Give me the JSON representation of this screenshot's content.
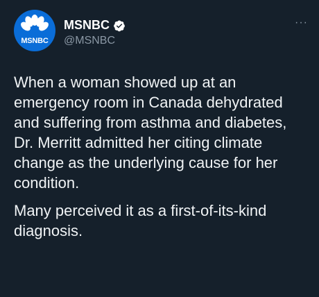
{
  "account": {
    "display_name": "MSNBC",
    "handle": "@MSNBC",
    "avatar_label": "MSNBC",
    "verified_icon": "verified-badge-icon",
    "avatar_color": "#0a6dd8"
  },
  "menu": {
    "more_label": "···"
  },
  "tweet": {
    "paragraphs": [
      "When a woman showed up at an emergency room in Canada dehydrated and suffering from asthma and diabetes, Dr. Merritt admitted her citing climate change as the underlying cause for her condition.",
      "Many perceived it as a first-of-its-kind diagnosis."
    ]
  },
  "colors": {
    "background": "#15202b",
    "text": "#ffffff",
    "secondary": "#8b98a5"
  }
}
